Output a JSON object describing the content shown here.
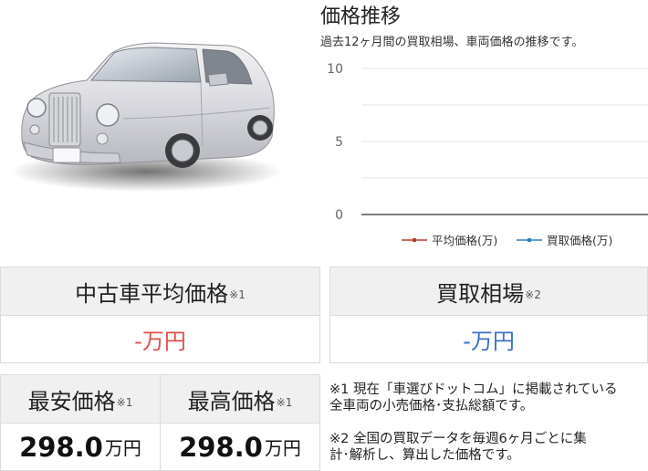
{
  "chart": {
    "title": "価格推移",
    "subtitle": "過去12ヶ月間の買取相場、車両価格の推移です。"
  },
  "chart_data": {
    "type": "line",
    "title": "価格推移",
    "subtitle": "過去12ヶ月間の買取相場、車両価格の推移です。",
    "xlabel": "",
    "ylabel": "",
    "ylim": [
      0,
      10
    ],
    "yticks": [
      "0",
      "5",
      "10"
    ],
    "grid": true,
    "legend": "bottom-right",
    "series": [
      {
        "name": "平均価格(万)",
        "color": "#c0392b",
        "values": []
      },
      {
        "name": "買取価格(万)",
        "color": "#2f7fb8",
        "values": []
      }
    ]
  },
  "avg_price": {
    "label": "中古車平均価格",
    "note": "※1",
    "value": "-万円"
  },
  "buy_price": {
    "label": "買取相場",
    "note": "※2",
    "value": "-万円"
  },
  "min_price": {
    "label": "最安価格",
    "note": "※1",
    "value": "298.0",
    "unit": "万円"
  },
  "max_price": {
    "label": "最高価格",
    "note": "※1",
    "value": "298.0",
    "unit": "万円"
  },
  "notes": {
    "note1_line1": "※1 現在「車選びドットコム」に掲載されている",
    "note1_line2": "全車両の小売価格･支払総額です。",
    "note2_line1": "※2 全国の買取データを毎週6ヶ月ごとに集",
    "note2_line2": "計･解析し、算出した価格です。"
  }
}
